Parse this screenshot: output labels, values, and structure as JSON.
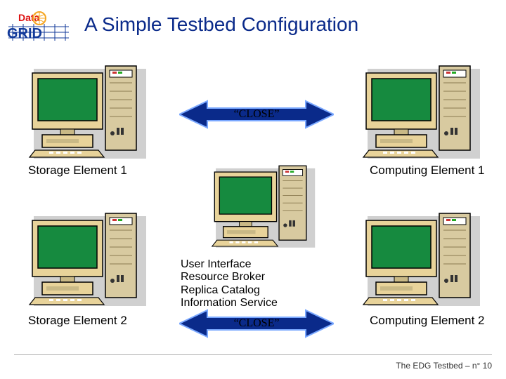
{
  "title": "A Simple Testbed Configuration",
  "logo": {
    "text_top": "Data",
    "text_bottom": "GRID"
  },
  "arrows": {
    "top_label": "“CLOSE”",
    "bottom_label": "“CLOSE”"
  },
  "nodes": {
    "storage1": "Storage Element 1",
    "storage2": "Storage Element 2",
    "compute1": "Computing Element 1",
    "compute2": "Computing Element 2"
  },
  "center_services": [
    "User Interface",
    "Resource Broker",
    "Replica Catalog",
    "Information Service"
  ],
  "footer": "The EDG Testbed – n° 10",
  "colors": {
    "title": "#0a2a8a",
    "monitor_screen": "#168a3f",
    "monitor_case": "#e8d39a",
    "tower_case": "#d8caa0",
    "arrow_fill": "#0a2a8a",
    "arrow_outline": "#7aa8ff"
  }
}
